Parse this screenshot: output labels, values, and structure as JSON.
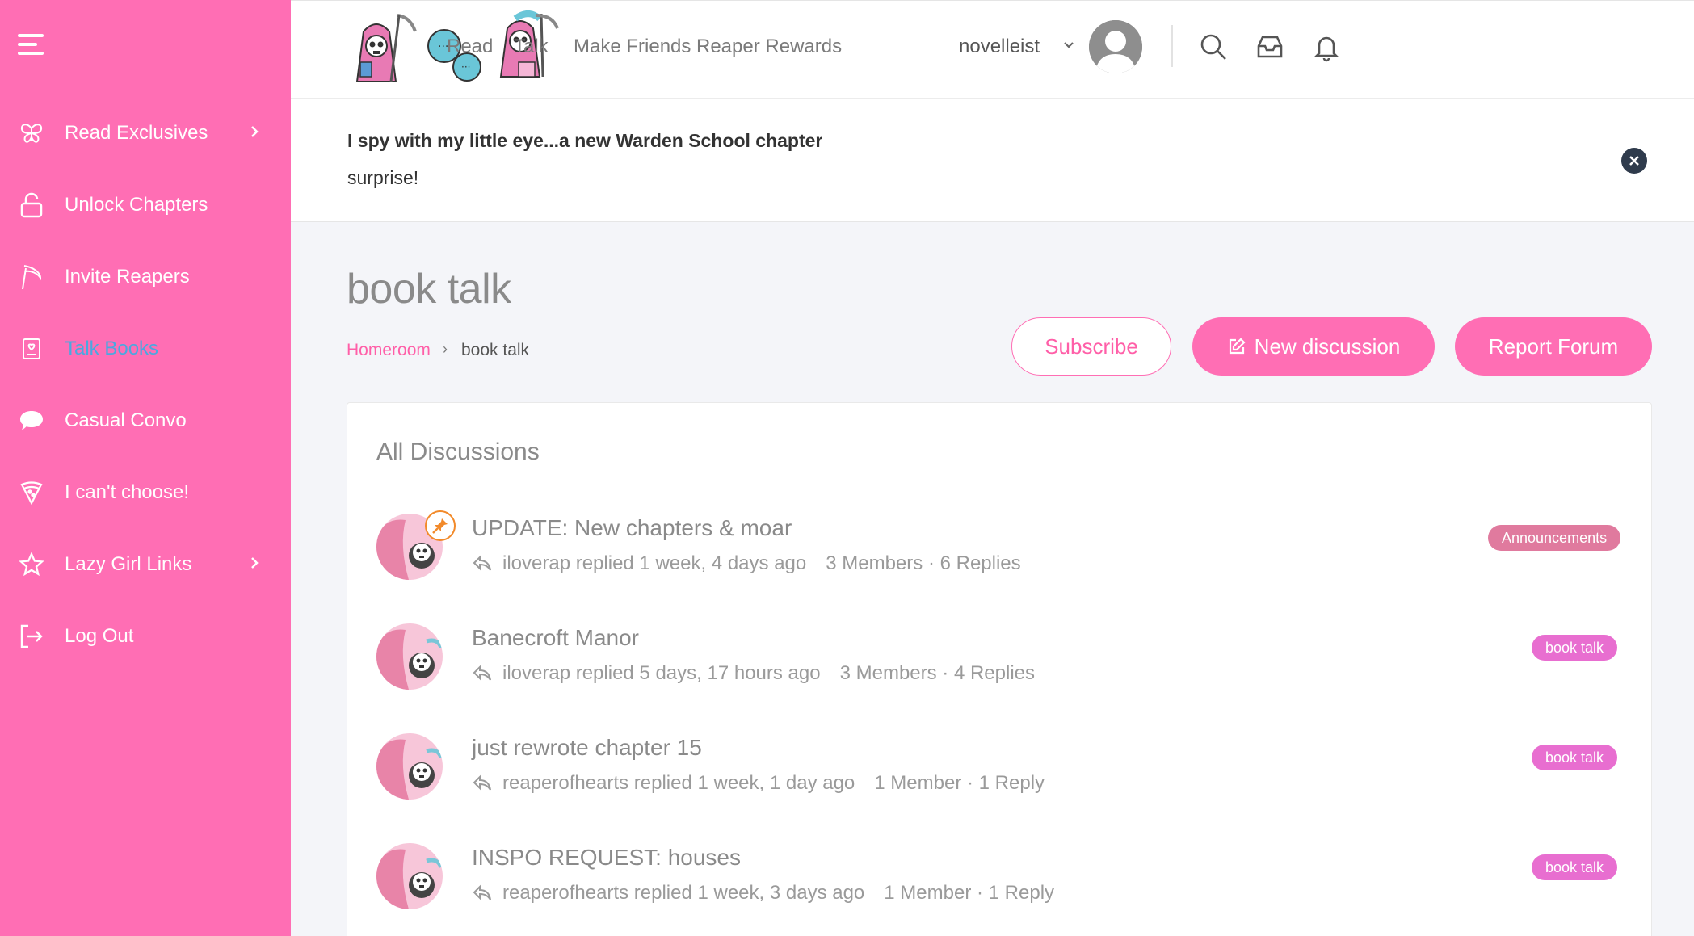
{
  "sidebar": {
    "items": [
      {
        "label": "Read Exclusives",
        "icon": "butterfly-icon",
        "has_chevron": true
      },
      {
        "label": "Unlock Chapters",
        "icon": "unlock-icon",
        "has_chevron": false
      },
      {
        "label": "Invite Reapers",
        "icon": "scythe-icon",
        "has_chevron": false
      },
      {
        "label": "Talk Books",
        "icon": "book-icon",
        "has_chevron": false,
        "active": true
      },
      {
        "label": "Casual Convo",
        "icon": "speech-bubble-icon",
        "has_chevron": false
      },
      {
        "label": "I can't choose!",
        "icon": "pizza-icon",
        "has_chevron": false
      },
      {
        "label": "Lazy Girl Links",
        "icon": "star-icon",
        "has_chevron": true
      },
      {
        "label": "Log Out",
        "icon": "logout-icon",
        "has_chevron": false
      }
    ]
  },
  "header": {
    "nav": [
      "Read",
      "Talk",
      "Make Friends",
      "Reaper Rewards"
    ],
    "username": "novelleist"
  },
  "announcement": {
    "line1": "I spy with my little eye...a new Warden School chapter",
    "line2": "surprise!"
  },
  "page": {
    "title": "book talk",
    "breadcrumb": {
      "home": "Homeroom",
      "separator": "›",
      "current": "book talk"
    }
  },
  "actions": {
    "subscribe": "Subscribe",
    "new_discussion": "New discussion",
    "report_forum": "Report Forum"
  },
  "discussions": {
    "heading": "All Discussions",
    "rows": [
      {
        "title": "UPDATE: New chapters & moar",
        "activity": "iloverap replied 1 week, 4 days ago",
        "stats": "3 Members · 6 Replies",
        "tag": "Announcements",
        "pinned": true
      },
      {
        "title": "Banecroft Manor",
        "activity": "iloverap replied 5 days, 17 hours ago",
        "stats": "3 Members · 4 Replies",
        "tag": "book talk",
        "pinned": false
      },
      {
        "title": "just rewrote chapter 15",
        "activity": "reaperofhearts replied 1 week, 1 day ago",
        "stats": "1 Member · 1 Reply",
        "tag": "book talk",
        "pinned": false
      },
      {
        "title": "INSPO REQUEST: houses",
        "activity": "reaperofhearts replied 1 week, 3 days ago",
        "stats": "1 Member · 1 Reply",
        "tag": "book talk",
        "pinned": false
      }
    ]
  },
  "colors": {
    "sidebar_bg": "#ff6eb4",
    "accent": "#ff5fa8",
    "active_link": "#4aa8e0",
    "tag_announcements": "#e07a9e",
    "tag_book_talk": "#e86ed0"
  }
}
